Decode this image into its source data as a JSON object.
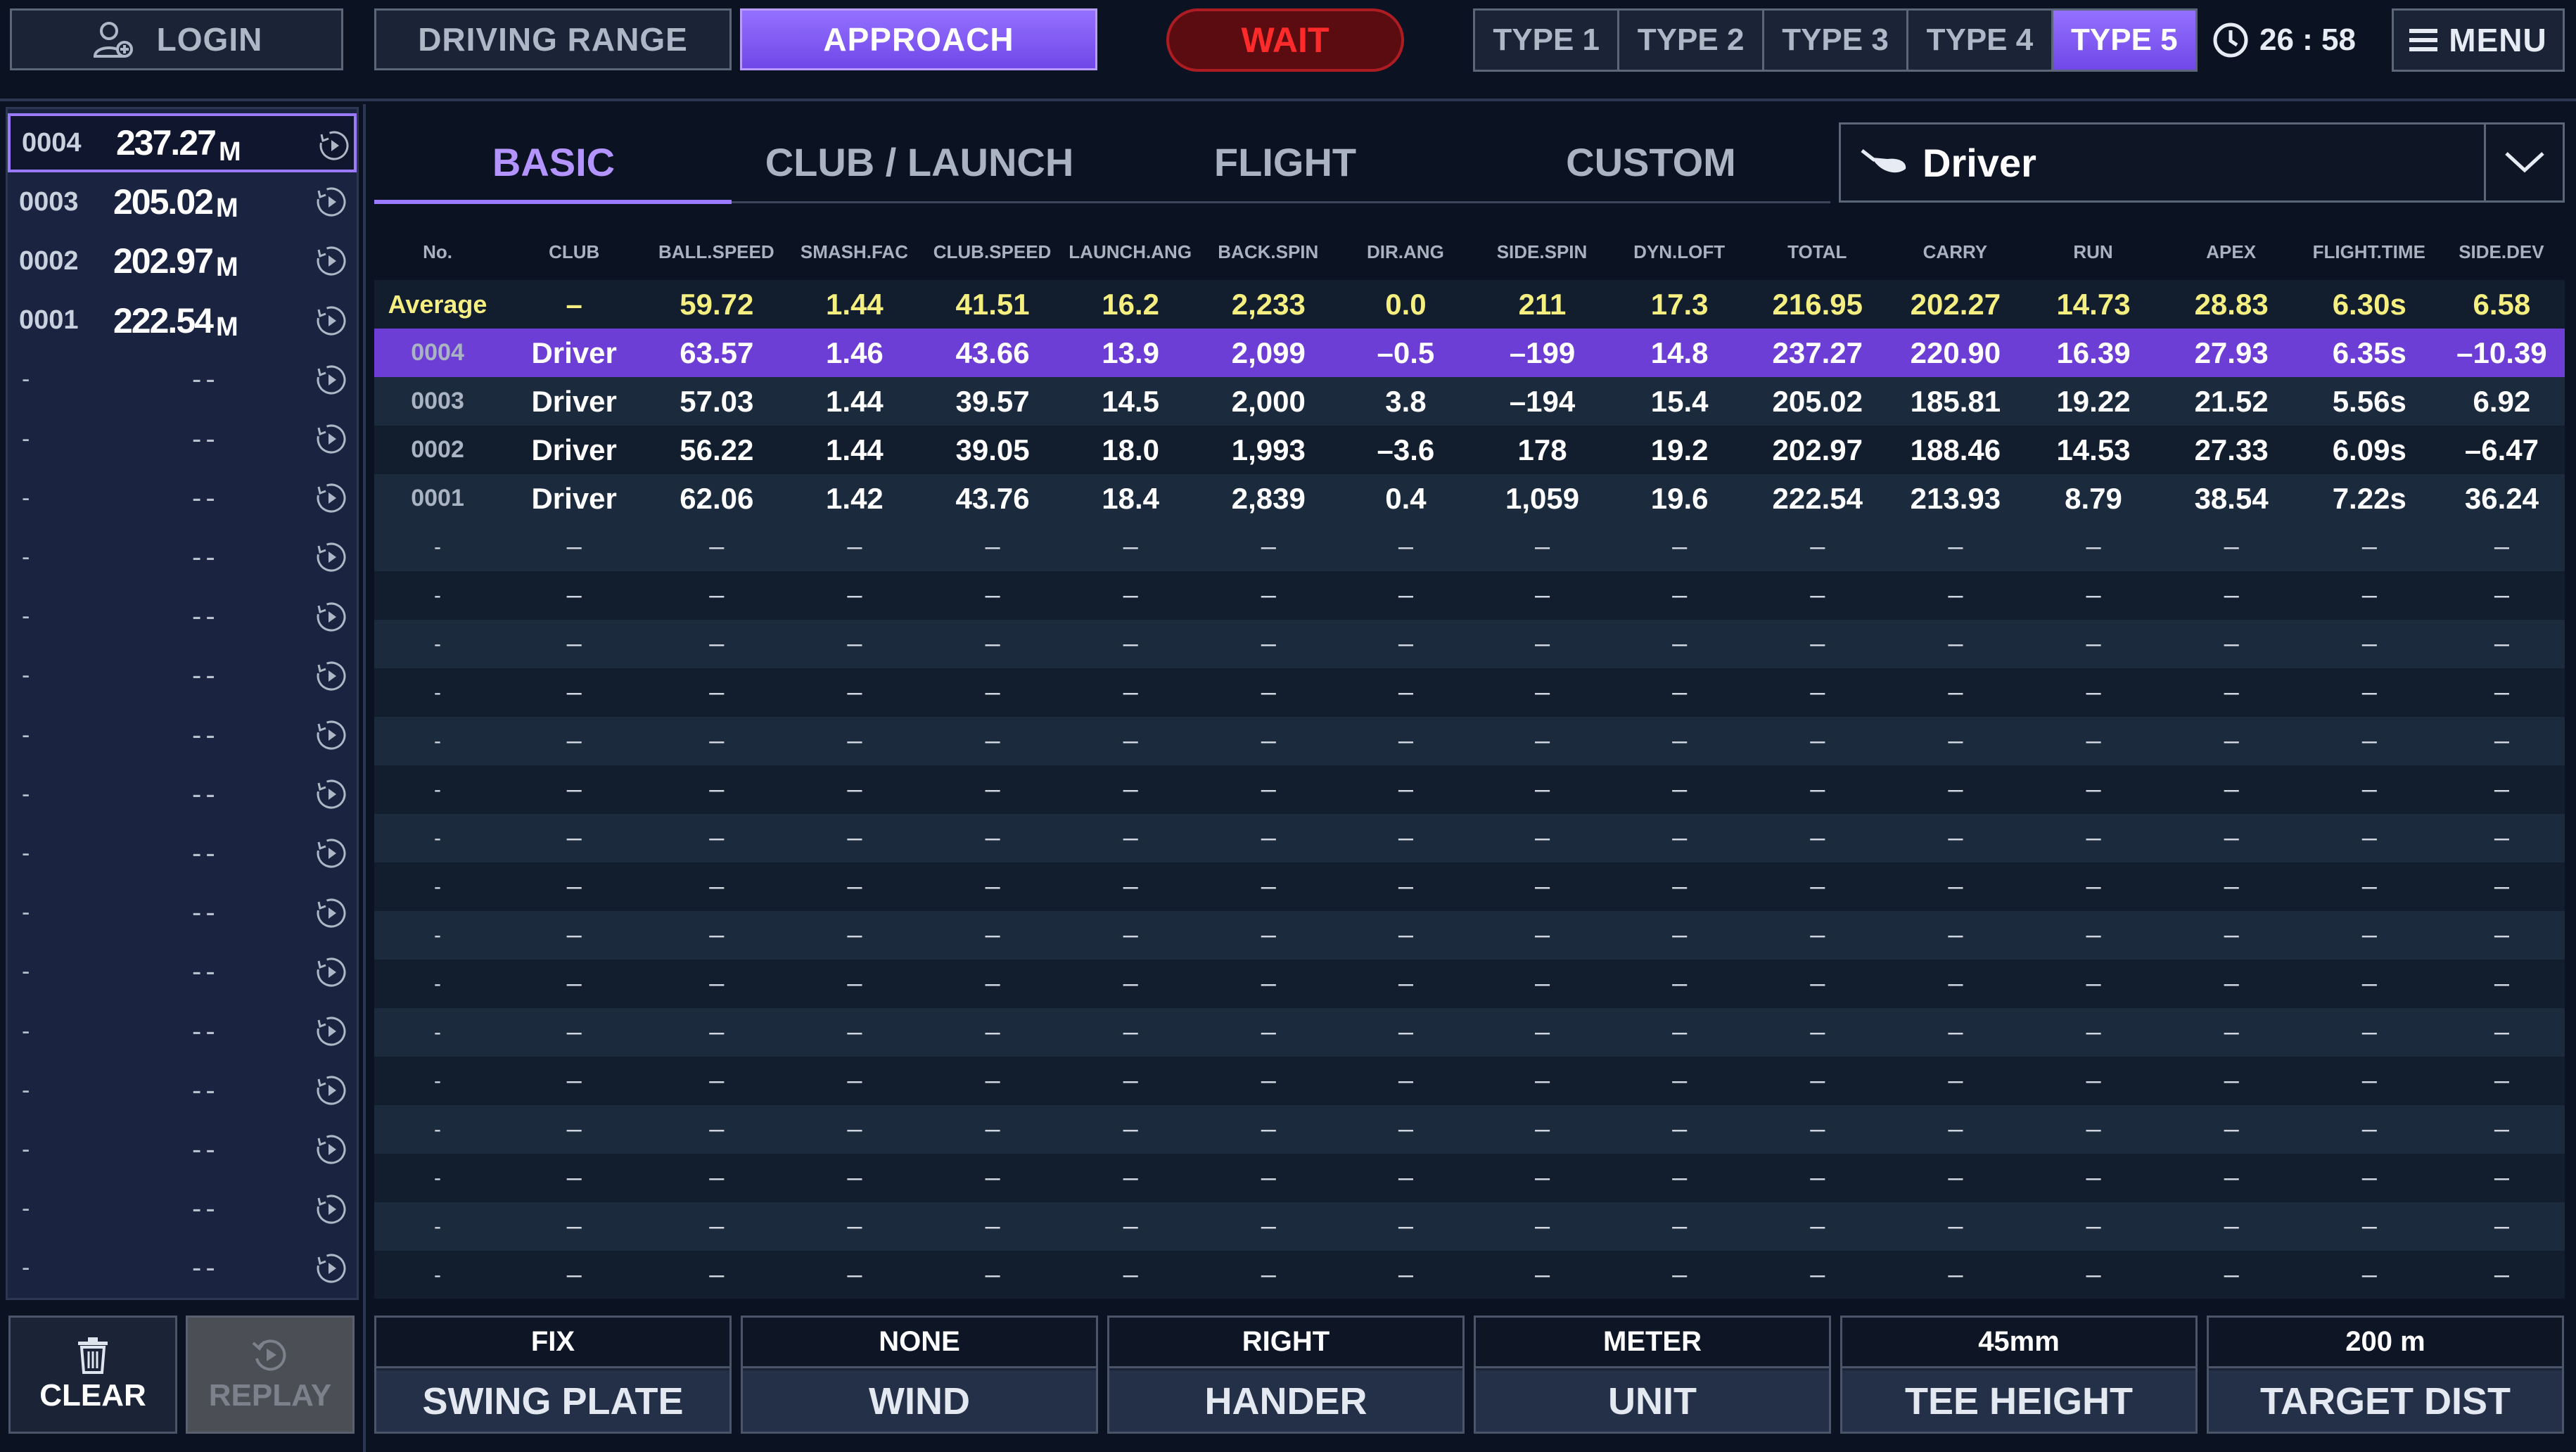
{
  "topbar": {
    "login": "LOGIN",
    "modes": [
      "DRIVING RANGE",
      "APPROACH"
    ],
    "wait": "WAIT",
    "types": [
      "TYPE 1",
      "TYPE 2",
      "TYPE 3",
      "TYPE 4",
      "TYPE 5"
    ],
    "timer": "26 : 58",
    "menu": "MENU"
  },
  "shots": [
    {
      "num": "0004",
      "dist": "237.27",
      "unit": "M"
    },
    {
      "num": "0003",
      "dist": "205.02",
      "unit": "M"
    },
    {
      "num": "0002",
      "dist": "202.97",
      "unit": "M"
    },
    {
      "num": "0001",
      "dist": "222.54",
      "unit": "M"
    }
  ],
  "empty_shot": {
    "dash": "-",
    "dist": "--"
  },
  "left_bottom": {
    "clear": "CLEAR",
    "replay": "REPLAY"
  },
  "tabs": [
    "BASIC",
    "CLUB / LAUNCH",
    "FLIGHT",
    "CUSTOM"
  ],
  "club_select": {
    "value": "Driver"
  },
  "table": {
    "headers": [
      "No.",
      "CLUB",
      "BALL.SPEED",
      "SMASH.FAC",
      "CLUB.SPEED",
      "LAUNCH.ANG",
      "BACK.SPIN",
      "DIR.ANG",
      "SIDE.SPIN",
      "DYN.LOFT",
      "TOTAL",
      "CARRY",
      "RUN",
      "APEX",
      "FLIGHT.TIME",
      "SIDE.DEV"
    ],
    "average": [
      "Average",
      "–",
      "59.72",
      "1.44",
      "41.51",
      "16.2",
      "2,233",
      "0.0",
      "211",
      "17.3",
      "216.95",
      "202.27",
      "14.73",
      "28.83",
      "6.30s",
      "6.58"
    ],
    "rows": [
      [
        "0004",
        "Driver",
        "63.57",
        "1.46",
        "43.66",
        "13.9",
        "2,099",
        "–0.5",
        "–199",
        "14.8",
        "237.27",
        "220.90",
        "16.39",
        "27.93",
        "6.35s",
        "–10.39"
      ],
      [
        "0003",
        "Driver",
        "57.03",
        "1.44",
        "39.57",
        "14.5",
        "2,000",
        "3.8",
        "–194",
        "15.4",
        "205.02",
        "185.81",
        "19.22",
        "21.52",
        "5.56s",
        "6.92"
      ],
      [
        "0002",
        "Driver",
        "56.22",
        "1.44",
        "39.05",
        "18.0",
        "1,993",
        "–3.6",
        "178",
        "19.2",
        "202.97",
        "188.46",
        "14.53",
        "27.33",
        "6.09s",
        "–6.47"
      ],
      [
        "0001",
        "Driver",
        "62.06",
        "1.42",
        "43.76",
        "18.4",
        "2,839",
        "0.4",
        "1,059",
        "19.6",
        "222.54",
        "213.93",
        "8.79",
        "38.54",
        "7.22s",
        "36.24"
      ]
    ],
    "empty_no": "-",
    "empty_cell": "–"
  },
  "settings": [
    {
      "value": "FIX",
      "label": "SWING PLATE"
    },
    {
      "value": "NONE",
      "label": "WIND"
    },
    {
      "value": "RIGHT",
      "label": "HANDER"
    },
    {
      "value": "METER",
      "label": "UNIT"
    },
    {
      "value": "45mm",
      "label": "TEE HEIGHT"
    },
    {
      "value": "200 m",
      "label": "TARGET DIST"
    }
  ],
  "colors": {
    "accent": "#7d55f0",
    "average": "#f4ef80",
    "wait": "#ff2a2a"
  }
}
